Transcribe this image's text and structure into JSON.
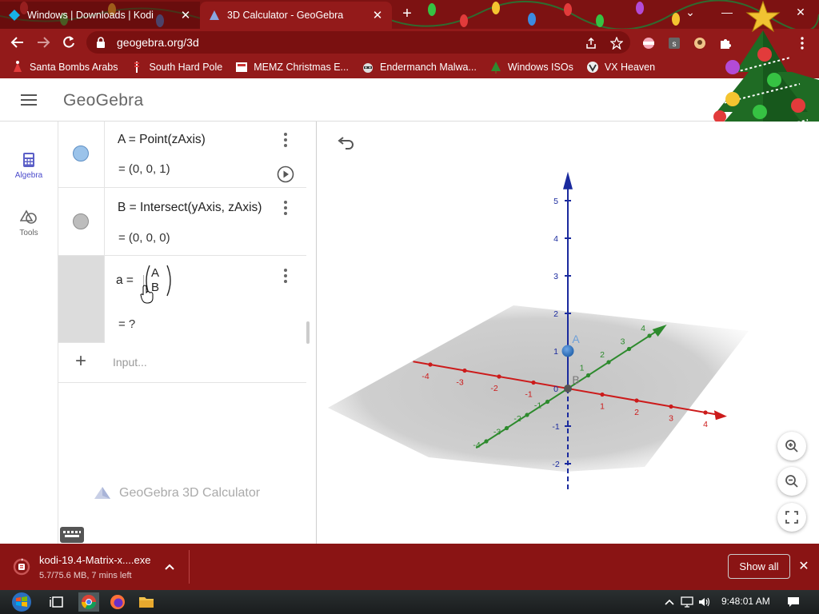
{
  "browser": {
    "tabs": [
      {
        "title": "Windows | Downloads | Kodi",
        "active": false
      },
      {
        "title": "3D Calculator - GeoGebra",
        "active": true
      }
    ],
    "url": "geogebra.org/3d",
    "bookmarks": [
      {
        "label": "Santa Bombs Arabs",
        "icon": "santa-icon"
      },
      {
        "label": "South Hard Pole",
        "icon": "pole-icon"
      },
      {
        "label": "MEMZ Christmas E...",
        "icon": "memz-icon"
      },
      {
        "label": "Endermanch Malwa...",
        "icon": "raccoon-icon"
      },
      {
        "label": "Windows ISOs",
        "icon": "tree-icon"
      },
      {
        "label": "VX Heaven",
        "icon": "vx-icon"
      }
    ]
  },
  "app": {
    "logo": "GeoGebra",
    "rail": [
      {
        "label": "Algebra",
        "icon": "calculator-icon",
        "active": true
      },
      {
        "label": "Tools",
        "icon": "shapes-icon",
        "active": false
      }
    ],
    "algebra": {
      "rows": [
        {
          "definition": "A  =  Point(zAxis)",
          "value": "=  (0, 0, 1)",
          "color": "#9bc3ea"
        },
        {
          "definition": "B  =  Intersect(yAxis, zAxis)",
          "value": "=  (0, 0, 0)",
          "color": "#bdbdbd"
        },
        {
          "lhs": "a =",
          "matrix_top": "A",
          "matrix_bottom": "B",
          "value": "=  ?"
        }
      ],
      "input_placeholder": "Input...",
      "brand": "GeoGebra 3D Calculator"
    },
    "view3d": {
      "z_ticks": [
        "5",
        "4",
        "3",
        "2",
        "1",
        "0",
        "-1",
        "-2"
      ],
      "y_ticks": [
        "-4",
        "-3",
        "-2",
        "-1",
        "1",
        "2",
        "3",
        "4"
      ],
      "x_ticks": [
        "-4",
        "-3",
        "-2",
        "-1",
        "1",
        "2",
        "3",
        "4"
      ],
      "point_a": "A",
      "point_b": "B",
      "axis_colors": {
        "x": "#cc1b1b",
        "y": "#2d8a2d",
        "z": "#1a2a9e"
      }
    }
  },
  "download": {
    "filename": "kodi-19.4-Matrix-x....exe",
    "status": "5.7/75.6 MB, 7 mins left",
    "show_all": "Show all"
  },
  "taskbar": {
    "time": "9:48:01 AM"
  }
}
